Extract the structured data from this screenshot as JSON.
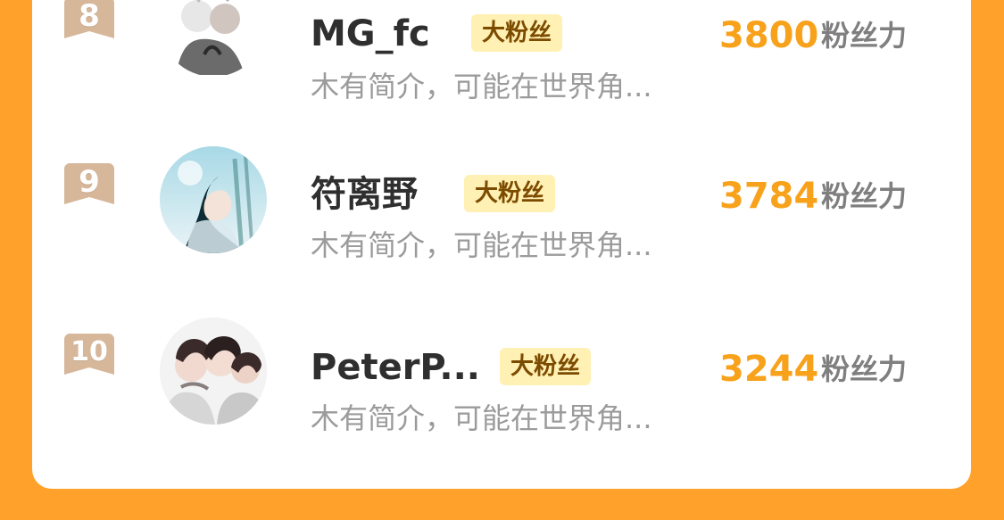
{
  "leaderboard": {
    "entries": [
      {
        "rank": "8",
        "name": "MG_fc",
        "badge": "大粉丝",
        "bio": "木有简介，可能在世界角...",
        "score": "3800",
        "score_unit": "粉丝力"
      },
      {
        "rank": "9",
        "name": "符离野",
        "badge": "大粉丝",
        "bio": "木有简介，可能在世界角...",
        "score": "3784",
        "score_unit": "粉丝力"
      },
      {
        "rank": "10",
        "name": "PeterP...",
        "badge": "大粉丝",
        "bio": "木有简介，可能在世界角...",
        "score": "3244",
        "score_unit": "粉丝力"
      }
    ]
  }
}
